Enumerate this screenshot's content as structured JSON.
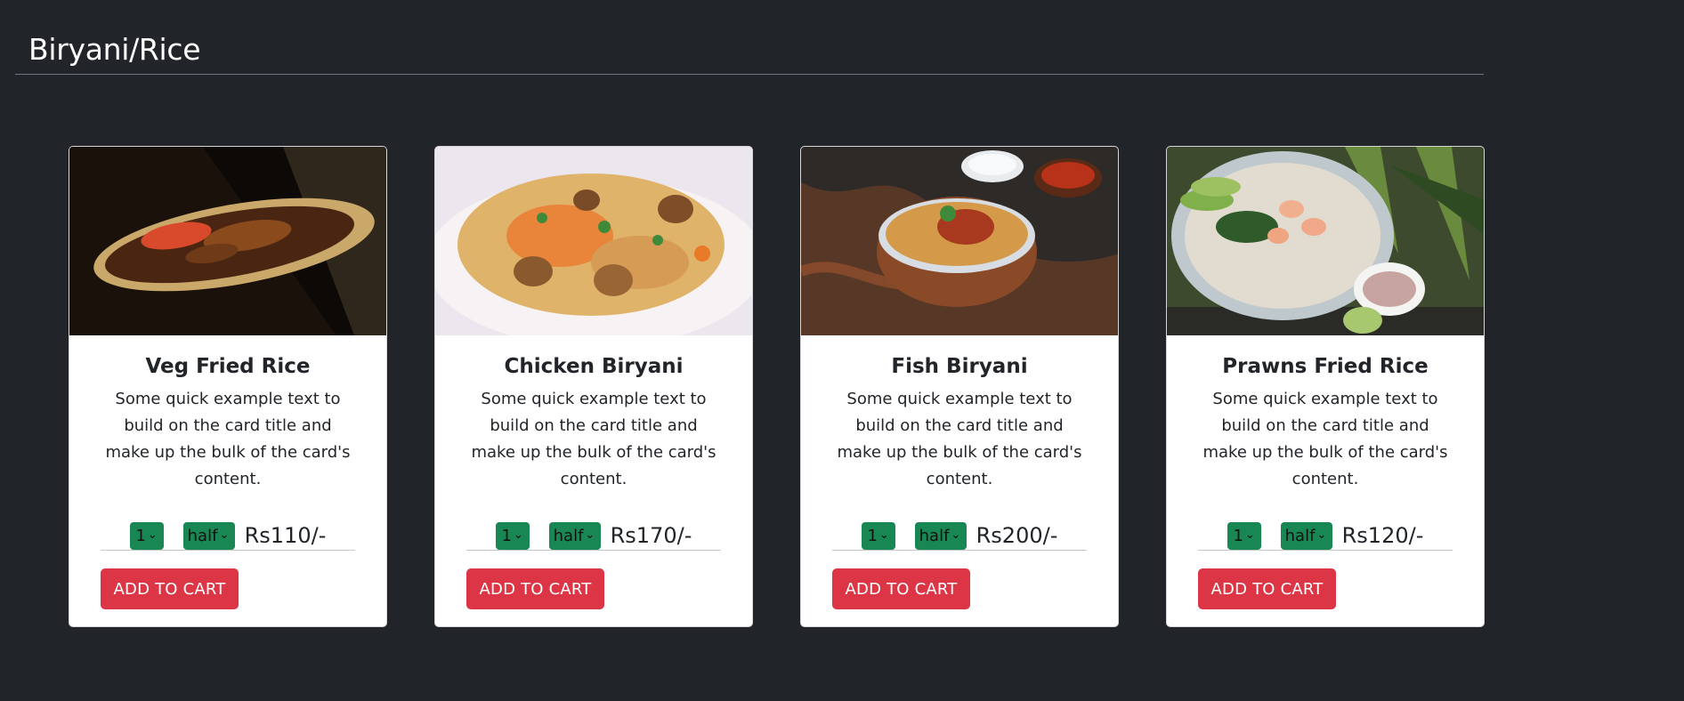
{
  "section": {
    "title": "Biryani/Rice"
  },
  "cards": [
    {
      "title": "Veg Fried Rice",
      "text": "Some quick example text to build on the card title and make up the bulk of the card's content.",
      "qty": "1",
      "size": "half",
      "price": "Rs110/-",
      "button": "ADD TO CART"
    },
    {
      "title": "Chicken Biryani",
      "text": "Some quick example text to build on the card title and make up the bulk of the card's content.",
      "qty": "1",
      "size": "half",
      "price": "Rs170/-",
      "button": "ADD TO CART"
    },
    {
      "title": "Fish Biryani",
      "text": "Some quick example text to build on the card title and make up the bulk of the card's content.",
      "qty": "1",
      "size": "half",
      "price": "Rs200/-",
      "button": "ADD TO CART"
    },
    {
      "title": "Prawns Fried Rice",
      "text": "Some quick example text to build on the card title and make up the bulk of the card's content.",
      "qty": "1",
      "size": "half",
      "price": "Rs120/-",
      "button": "ADD TO CART"
    }
  ],
  "colors": {
    "background": "#212529",
    "select": "#198754",
    "button": "#dc3545"
  },
  "icons": {
    "select_arrow": "chevron-down-icon"
  }
}
